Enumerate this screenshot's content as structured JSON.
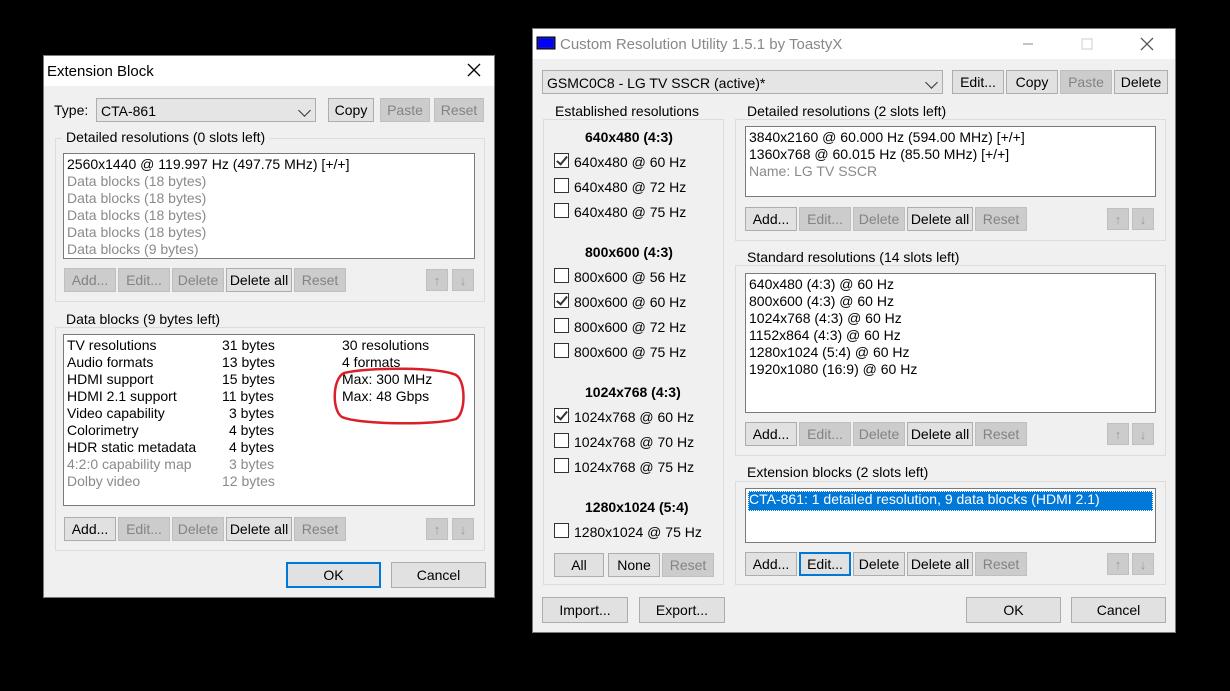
{
  "ext": {
    "title": "Extension Block",
    "type_label": "Type:",
    "type_value": "CTA-861",
    "buttons": {
      "copy": "Copy",
      "paste": "Paste",
      "reset": "Reset"
    },
    "detailed_label": "Detailed resolutions (0 slots left)",
    "detailed_items": [
      "2560x1440 @ 119.997 Hz (497.75 MHz) [+/+]",
      "Data blocks (18 bytes)",
      "Data blocks (18 bytes)",
      "Data blocks (18 bytes)",
      "Data blocks (18 bytes)",
      "Data blocks (9 bytes)"
    ],
    "row_buttons": {
      "add": "Add...",
      "edit": "Edit...",
      "delete": "Delete",
      "delete_all": "Delete all",
      "reset": "Reset"
    },
    "datablocks_label": "Data blocks (9 bytes left)",
    "datablocks": [
      {
        "name": "TV resolutions",
        "size": "31 bytes",
        "info": "30 resolutions"
      },
      {
        "name": "Audio formats",
        "size": "13 bytes",
        "info": "4 formats"
      },
      {
        "name": "HDMI support",
        "size": "15 bytes",
        "info": "Max: 300 MHz"
      },
      {
        "name": "HDMI 2.1 support",
        "size": "11 bytes",
        "info": "Max: 48 Gbps"
      },
      {
        "name": "Video capability",
        "size": "3 bytes",
        "info": ""
      },
      {
        "name": "Colorimetry",
        "size": "4 bytes",
        "info": ""
      },
      {
        "name": "HDR static metadata",
        "size": "4 bytes",
        "info": ""
      },
      {
        "name": "4:2:0 capability map",
        "size": "3 bytes",
        "info": ""
      },
      {
        "name": "Dolby video",
        "size": "12 bytes",
        "info": ""
      }
    ],
    "ok": "OK",
    "cancel": "Cancel"
  },
  "cru": {
    "title": "Custom Resolution Utility 1.5.1 by ToastyX",
    "monitor": "GSMC0C8 - LG TV SSCR (active)*",
    "top_buttons": {
      "edit": "Edit...",
      "copy": "Copy",
      "paste": "Paste",
      "delete": "Delete"
    },
    "established_label": "Established resolutions",
    "established_groups": [
      {
        "heading": "640x480 (4:3)",
        "items": [
          {
            "label": "640x480 @ 60 Hz",
            "checked": true
          },
          {
            "label": "640x480 @ 72 Hz",
            "checked": false
          },
          {
            "label": "640x480 @ 75 Hz",
            "checked": false
          }
        ]
      },
      {
        "heading": "800x600 (4:3)",
        "items": [
          {
            "label": "800x600 @ 56 Hz",
            "checked": false
          },
          {
            "label": "800x600 @ 60 Hz",
            "checked": true
          },
          {
            "label": "800x600 @ 72 Hz",
            "checked": false
          },
          {
            "label": "800x600 @ 75 Hz",
            "checked": false
          }
        ]
      },
      {
        "heading": "1024x768 (4:3)",
        "items": [
          {
            "label": "1024x768 @ 60 Hz",
            "checked": true
          },
          {
            "label": "1024x768 @ 70 Hz",
            "checked": false
          },
          {
            "label": "1024x768 @ 75 Hz",
            "checked": false
          }
        ]
      },
      {
        "heading": "1280x1024 (5:4)",
        "items": [
          {
            "label": "1280x1024 @ 75 Hz",
            "checked": false
          }
        ]
      }
    ],
    "est_buttons": {
      "all": "All",
      "none": "None",
      "reset": "Reset"
    },
    "detailed_label": "Detailed resolutions (2 slots left)",
    "detailed_items": [
      "3840x2160 @ 60.000 Hz (594.00 MHz) [+/+]",
      "1360x768 @ 60.015 Hz (85.50 MHz) [+/+]",
      "Name: LG TV SSCR"
    ],
    "standard_label": "Standard resolutions (14 slots left)",
    "standard_items": [
      "640x480 (4:3) @ 60 Hz",
      "800x600 (4:3) @ 60 Hz",
      "1024x768 (4:3) @ 60 Hz",
      "1152x864 (4:3) @ 60 Hz",
      "1280x1024 (5:4) @ 60 Hz",
      "1920x1080 (16:9) @ 60 Hz"
    ],
    "extension_label": "Extension blocks (2 slots left)",
    "extension_items": [
      "CTA-861: 1 detailed resolution, 9 data blocks (HDMI 2.1)"
    ],
    "row_buttons": {
      "add": "Add...",
      "edit": "Edit...",
      "delete": "Delete",
      "delete_all": "Delete all",
      "reset": "Reset"
    },
    "import": "Import...",
    "export": "Export...",
    "ok": "OK",
    "cancel": "Cancel"
  },
  "icons": {
    "close": "close-icon",
    "minimize": "minimize-icon",
    "maximize": "maximize-icon",
    "up": "arrow-up-icon",
    "down": "arrow-down-icon",
    "monitor": "monitor-icon"
  },
  "colors": {
    "accent": "#0078d7",
    "highlight_oval": "#d9202a"
  }
}
